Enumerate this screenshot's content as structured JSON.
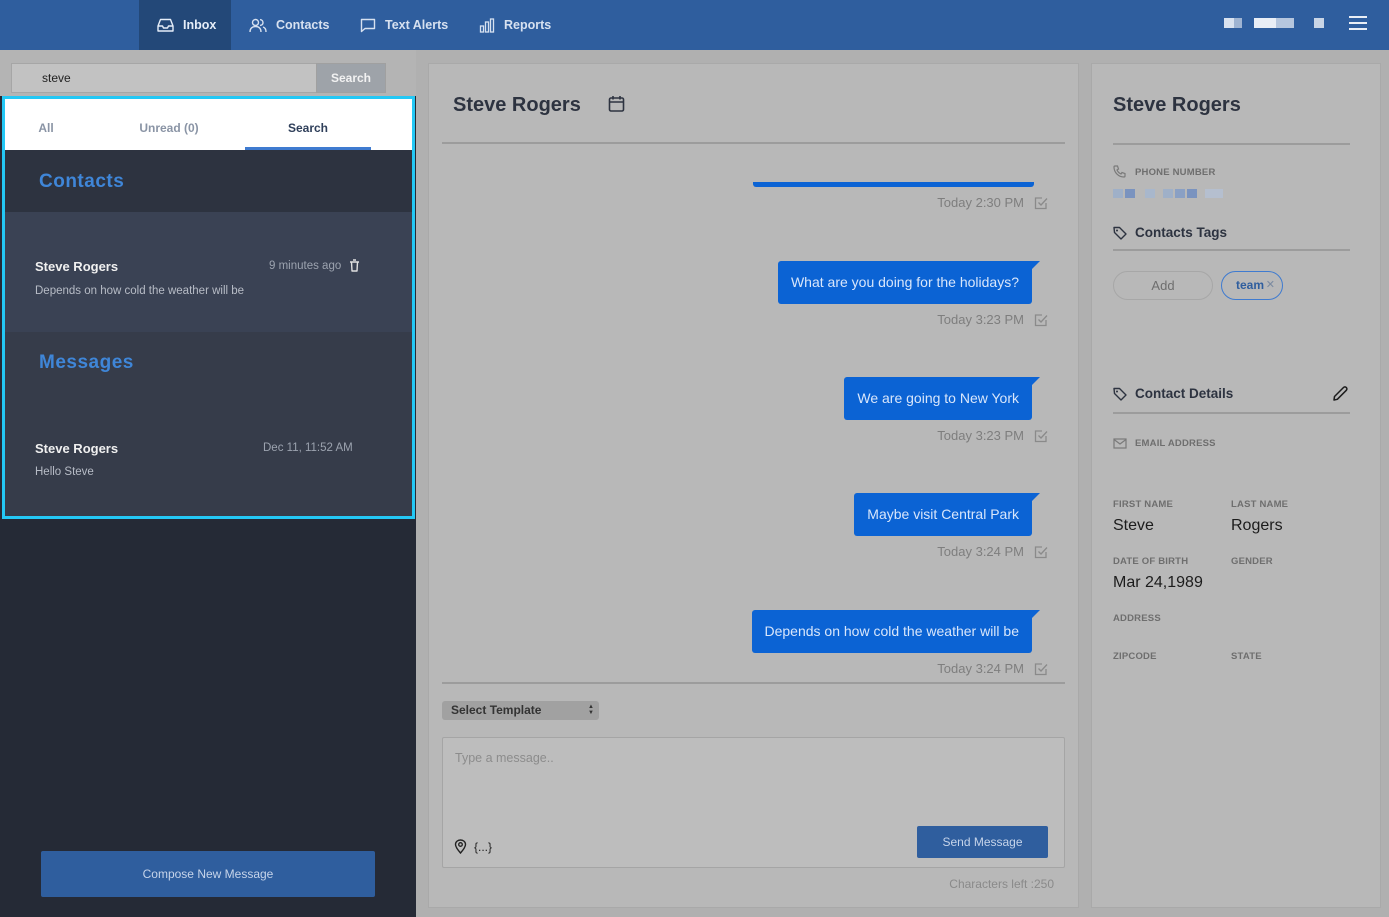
{
  "nav": {
    "tabs": [
      {
        "label": "Inbox",
        "icon": "inbox-icon",
        "active": true
      },
      {
        "label": "Contacts",
        "icon": "people-icon",
        "active": false
      },
      {
        "label": "Text Alerts",
        "icon": "chat-icon",
        "active": false
      },
      {
        "label": "Reports",
        "icon": "bar-chart-icon",
        "active": false
      }
    ]
  },
  "search": {
    "value": "steve",
    "button": "Search"
  },
  "results": {
    "tabs": [
      "All",
      "Unread (0)",
      "Search"
    ],
    "active_tab": "Search",
    "contacts_heading": "Contacts",
    "contact": {
      "name": "Steve Rogers",
      "time": "9 minutes ago",
      "preview": "Depends on how cold the weather will be"
    },
    "messages_heading": "Messages",
    "message": {
      "name": "Steve Rogers",
      "time": "Dec 11, 11:52 AM",
      "preview": "Hello Steve"
    }
  },
  "compose_button": "Compose New Message",
  "conversation": {
    "title": "Steve Rogers",
    "messages": [
      {
        "text": "",
        "time": "Today 2:30 PM"
      },
      {
        "text": "What are you doing for the holidays?",
        "time": "Today 3:23 PM"
      },
      {
        "text": "We are going to New York",
        "time": "Today 3:23 PM"
      },
      {
        "text": "Maybe visit Central Park",
        "time": "Today 3:24 PM"
      },
      {
        "text": "Depends on how cold the weather will be",
        "time": "Today 3:24 PM"
      }
    ],
    "template_select": "Select Template",
    "input_placeholder": "Type a message..",
    "variables_button": "{...}",
    "send_button": "Send Message",
    "chars_left": "Characters left :250"
  },
  "contact_panel": {
    "title": "Steve Rogers",
    "phone_label": "PHONE NUMBER",
    "tags_heading": "Contacts Tags",
    "add_tag": "Add",
    "tags": [
      "team"
    ],
    "details_heading": "Contact Details",
    "email_label": "EMAIL ADDRESS",
    "first_name_label": "FIRST NAME",
    "first_name": "Steve",
    "last_name_label": "LAST NAME",
    "last_name": "Rogers",
    "dob_label": "DATE OF BIRTH",
    "dob": "Mar 24,1989",
    "gender_label": "GENDER",
    "address_label": "ADDRESS",
    "zipcode_label": "ZIPCODE",
    "state_label": "STATE"
  },
  "colors": {
    "nav": "#2f5e9e",
    "accent": "#3f86d8",
    "bubble": "#0b63d4",
    "highlight": "#24c8f5"
  }
}
